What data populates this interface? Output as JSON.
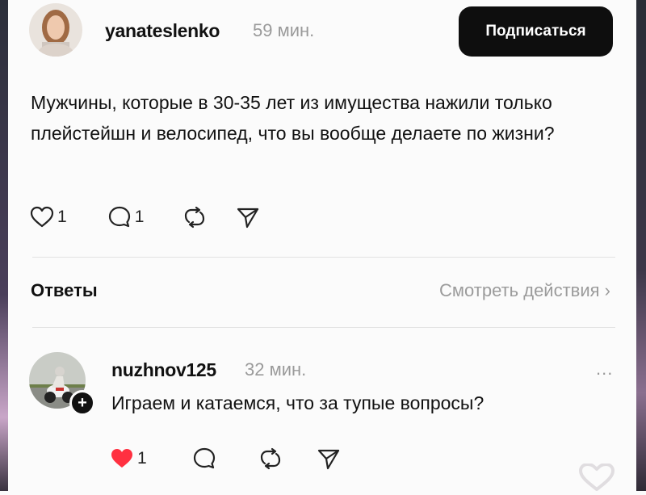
{
  "post": {
    "username": "yanateslenko",
    "time": "59 мин.",
    "follow_label": "Подписаться",
    "text": "Мужчины, которые в 30-35 лет из имущества нажили только плейстейшн и велосипед, что вы вообще делаете по жизни?",
    "actions": {
      "likes": "1",
      "comments": "1",
      "like_icon": "heart-outline-icon",
      "comment_icon": "speech-bubble-icon",
      "repost_icon": "repost-icon",
      "share_icon": "send-icon"
    }
  },
  "replies_section": {
    "title": "Ответы",
    "view_activity": "Смотреть действия ›"
  },
  "reply": {
    "username": "nuzhnov125",
    "time": "32 мин.",
    "text": "Играем и катаемся, что за тупые вопросы?",
    "more": "...",
    "add_badge": "+",
    "actions": {
      "likes": "1",
      "liked": true,
      "like_color": "#ff3040",
      "like_icon": "heart-filled-icon",
      "comment_icon": "speech-bubble-icon",
      "repost_icon": "repost-icon",
      "share_icon": "send-icon"
    }
  }
}
